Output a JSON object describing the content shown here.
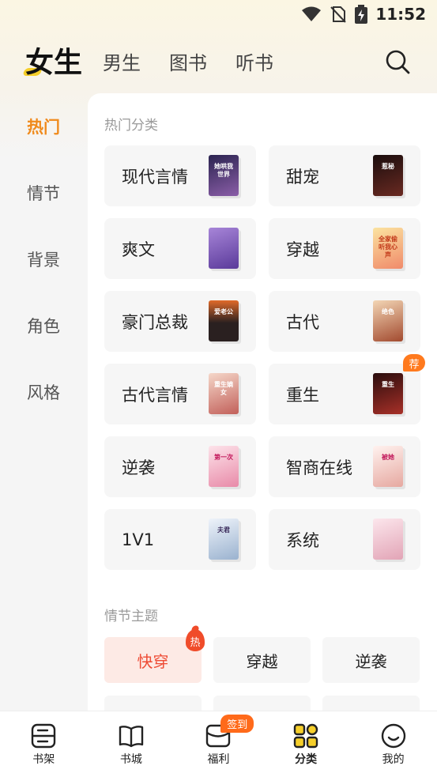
{
  "status_bar": {
    "time": "11:52"
  },
  "top_tabs": [
    {
      "label": "女生",
      "active": true
    },
    {
      "label": "男生",
      "active": false
    },
    {
      "label": "图书",
      "active": false
    },
    {
      "label": "听书",
      "active": false
    }
  ],
  "sidebar": {
    "items": [
      {
        "label": "热门",
        "active": true
      },
      {
        "label": "情节",
        "active": false
      },
      {
        "label": "背景",
        "active": false
      },
      {
        "label": "角色",
        "active": false
      },
      {
        "label": "风格",
        "active": false
      }
    ]
  },
  "hot_categories": {
    "title": "热门分类",
    "items": [
      {
        "label": "现代言情",
        "cover_text": "她哄我世界",
        "cover_color": "#5a3d6b"
      },
      {
        "label": "甜宠",
        "cover_text": "惹秘",
        "cover_color": "#3a1a1a"
      },
      {
        "label": "爽文",
        "cover_text": "",
        "cover_color": "#7a5fb5"
      },
      {
        "label": "穿越",
        "cover_text": "全家偷听我心声",
        "cover_color": "#e97a5a"
      },
      {
        "label": "豪门总裁",
        "cover_text": "爱老公",
        "cover_color": "#2c2a2a"
      },
      {
        "label": "古代",
        "cover_text": "绝色",
        "cover_color": "#a24a2f"
      },
      {
        "label": "古代言情",
        "cover_text": "重生嫡女",
        "cover_color": "#e0a7a2"
      },
      {
        "label": "重生",
        "cover_text": "重生",
        "cover_color": "#7a1f1f",
        "badge": "荐"
      },
      {
        "label": "逆袭",
        "cover_text": "第一次",
        "cover_color": "#f0b7c8"
      },
      {
        "label": "智商在线",
        "cover_text": "被她",
        "cover_color": "#efd8d6"
      },
      {
        "label": "1V1",
        "cover_text": "夫君",
        "cover_color": "#c9d6e6"
      },
      {
        "label": "系统",
        "cover_text": "",
        "cover_color": "#f2cdd6"
      }
    ]
  },
  "plot_topics": {
    "title": "情节主题",
    "tags": [
      {
        "label": "快穿",
        "hot": true,
        "badge": "热"
      },
      {
        "label": "穿越",
        "hot": false
      },
      {
        "label": "逆袭",
        "hot": false
      }
    ]
  },
  "bottom_nav": [
    {
      "label": "书架",
      "icon": "bookshelf-icon",
      "active": false
    },
    {
      "label": "书城",
      "icon": "book-open-icon",
      "active": false
    },
    {
      "label": "福利",
      "icon": "gift-box-icon",
      "active": false,
      "badge": "签到"
    },
    {
      "label": "分类",
      "icon": "category-grid-icon",
      "active": true
    },
    {
      "label": "我的",
      "icon": "smile-face-icon",
      "active": false
    }
  ],
  "colors": {
    "accent": "#f08a1c",
    "hot_tag_bg": "#fdeae5",
    "hot_tag_text": "#ee4b34",
    "badge": "#ff7a1e",
    "highlight": "#f6cf2a"
  }
}
